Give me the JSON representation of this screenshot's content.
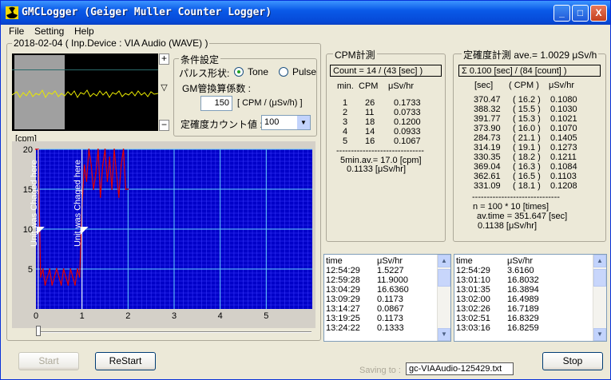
{
  "window": {
    "title": "GMCLogger (Geiger Muller Counter Logger)",
    "minimize": "_",
    "maximize": "□",
    "close": "X"
  },
  "menu": [
    "File",
    "Setting",
    "Help"
  ],
  "date_device": "2018-02-04 ( Inp.Device : VIA Audio (WAVE) )",
  "wave": {
    "plus": "+",
    "minus": "−",
    "marker": "▽"
  },
  "settings": {
    "legend": "条件設定",
    "pulse_label": "パルス形状:",
    "tone": "Tone",
    "pulse": "Pulse",
    "selected": "Tone",
    "gm_label": "GM管換算係数 :",
    "gm_value": "150",
    "gm_unit": "[ CPM / (μSv/h) ]",
    "count_label": "定確度カウント値 :",
    "count_value": "100",
    "dropdown_arrow": "▼"
  },
  "cpm": {
    "legend": "CPM計測",
    "count_box": "Count = 14 / (43 [sec] )",
    "headers": [
      "min.",
      "CPM",
      "μSv/hr"
    ],
    "rows": [
      [
        "1",
        "26",
        "0.1733"
      ],
      [
        "2",
        "11",
        "0.0733"
      ],
      [
        "3",
        "18",
        "0.1200"
      ],
      [
        "4",
        "14",
        "0.0933"
      ],
      [
        "5",
        "16",
        "0.1067"
      ]
    ],
    "separator": "------------------------------",
    "avg1": "5min.av.= 17.0 [cpm]",
    "avg2": "0.1133 [μSv/hr]"
  },
  "accuracy": {
    "legend": "定確度計測 ave.= 1.0029 μSv/h",
    "sum_box": "Σ 0.100 [sec] / (84 [count] )",
    "headers": [
      "[sec]",
      "( CPM )",
      "μSv/hr"
    ],
    "rows": [
      [
        "370.47",
        "( 16.2 )",
        "0.1080"
      ],
      [
        "388.32",
        "( 15.5 )",
        "0.1030"
      ],
      [
        "391.77",
        "( 15.3 )",
        "0.1021"
      ],
      [
        "373.90",
        "( 16.0 )",
        "0.1070"
      ],
      [
        "284.73",
        "( 21.1 )",
        "0.1405"
      ],
      [
        "314.19",
        "( 19.1 )",
        "0.1273"
      ],
      [
        "330.35",
        "( 18.2 )",
        "0.1211"
      ],
      [
        "369.04",
        "( 16.3 )",
        "0.1084"
      ],
      [
        "362.61",
        "( 16.5 )",
        "0.1103"
      ],
      [
        "331.09",
        "( 18.1 )",
        "0.1208"
      ]
    ],
    "separator": "------------------------------",
    "n": "n = 100 * 10 [times]",
    "avtime": "av.time = 351.647 [sec]",
    "usv": "0.1138 [μSv/hr]"
  },
  "log1": {
    "headers": [
      "time",
      "μSv/hr"
    ],
    "rows": [
      [
        "12:54:29",
        "1.5227"
      ],
      [
        "12:59:28",
        "11.9000"
      ],
      [
        "13:04:29",
        "16.6360"
      ],
      [
        "13:09:29",
        "0.1173"
      ],
      [
        "13:14:27",
        "0.0867"
      ],
      [
        "13:19:25",
        "0.1173"
      ],
      [
        "13:24:22",
        "0.1333"
      ]
    ]
  },
  "log2": {
    "headers": [
      "time",
      "μSv/hr"
    ],
    "rows": [
      [
        "12:54:29",
        "3.6160"
      ],
      [
        "13:01:10",
        "16.8032"
      ],
      [
        "13:01:35",
        "16.3894"
      ],
      [
        "13:02:00",
        "16.4989"
      ],
      [
        "13:02:26",
        "16.7189"
      ],
      [
        "13:02:51",
        "16.8329"
      ],
      [
        "13:03:16",
        "16.8259"
      ]
    ]
  },
  "chart_data": {
    "type": "line",
    "ylabel": "[cpm]",
    "xlim": [
      0,
      6
    ],
    "ylim": [
      0,
      20
    ],
    "x_ticks": [
      "0",
      "1",
      "2",
      "3",
      "4",
      "5"
    ],
    "y_ticks": [
      "5",
      "10",
      "15",
      "20"
    ],
    "annotations": [
      {
        "text": "Unit was Chaged here",
        "x": 0.05
      },
      {
        "text": "Unit was Chaged here",
        "x": 1.0
      }
    ],
    "background": "#0000c8",
    "line_color": "#e00000",
    "x": [
      0.0,
      0.05,
      0.1,
      0.15,
      0.2,
      0.25,
      0.3,
      0.35,
      0.4,
      0.45,
      0.5,
      0.55,
      0.6,
      0.65,
      0.7,
      0.75,
      0.8,
      0.85,
      0.9,
      0.95,
      1.0,
      1.05,
      1.1,
      1.15,
      1.2,
      1.25,
      1.3,
      1.35,
      1.4,
      1.45,
      1.5,
      1.55,
      1.6,
      1.65,
      1.7,
      1.75,
      1.8,
      1.85,
      1.9,
      1.95,
      2.0
    ],
    "values": [
      20,
      20,
      4,
      5,
      3,
      4,
      5,
      3,
      4,
      5,
      4,
      3,
      5,
      4,
      3,
      5,
      4,
      3,
      5,
      4,
      13,
      18,
      16,
      20,
      18,
      15,
      17,
      20,
      14,
      18,
      20,
      16,
      19,
      15,
      20,
      17,
      14,
      18,
      20,
      15,
      15
    ]
  },
  "footer": {
    "start": "Start",
    "restart": "ReStart",
    "saving_label": "Saving to :",
    "saving_file": "gc-VIAAudio-125429.txt",
    "stop": "Stop"
  },
  "colors": {
    "titlebar": "#0a5ae8",
    "chart_bg": "#0000c8",
    "waveform": "#e0e000"
  }
}
